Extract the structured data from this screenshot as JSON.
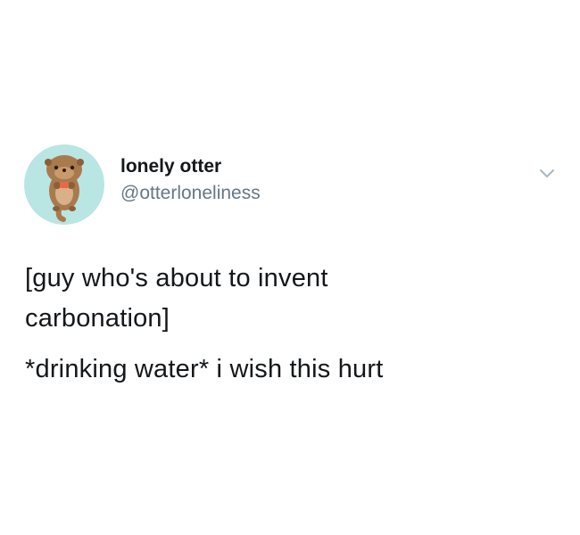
{
  "tweet": {
    "author": {
      "display_name": "lonely otter",
      "handle": "@otterloneliness",
      "avatar_icon": "otter-avatar-icon",
      "avatar_bg": "#b9e6e2"
    },
    "menu_icon": "chevron-down-icon",
    "text_lines": [
      "[guy who's about to invent",
      "carbonation]",
      "*drinking water* i wish this hurt"
    ]
  }
}
